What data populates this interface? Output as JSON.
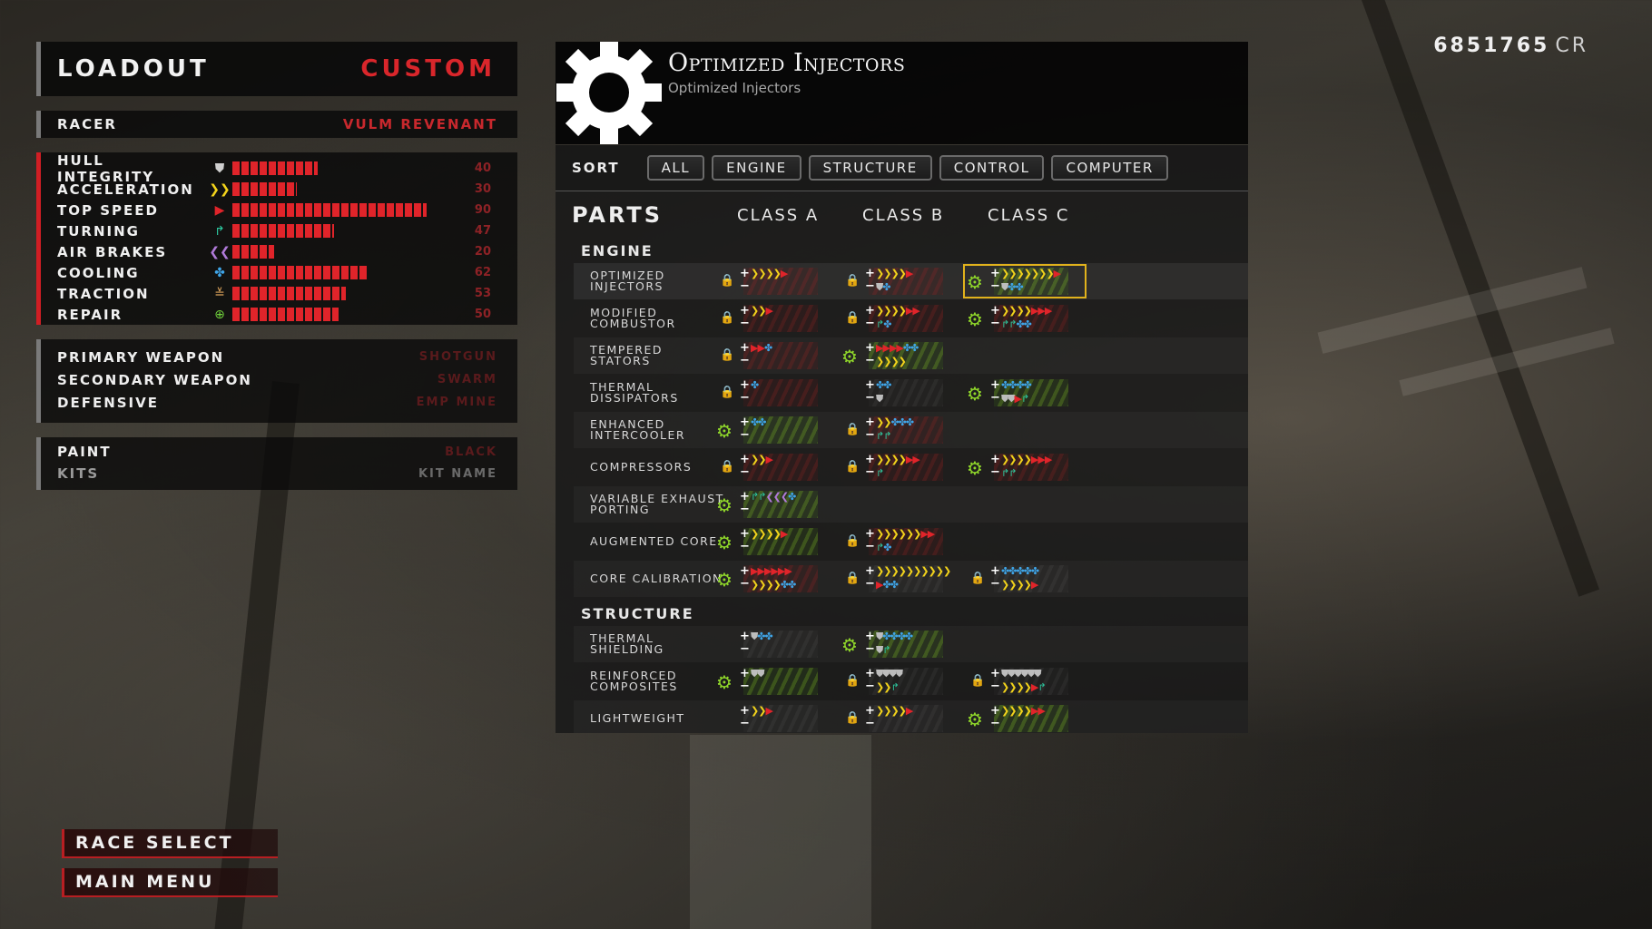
{
  "credits": {
    "value": "6851765",
    "unit": "CR"
  },
  "loadout": {
    "title": "LOADOUT",
    "mode": "CUSTOM"
  },
  "racer": {
    "label": "RACER",
    "value": "VULM REVENANT"
  },
  "stats": [
    {
      "label": "HULL INTEGRITY",
      "icon": "shield-icon",
      "glyph": "⛊",
      "color": "#cfcfcf",
      "value": "40",
      "fill": 0.37
    },
    {
      "label": "ACCELERATION",
      "icon": "acceleration-icon",
      "glyph": "❯❯",
      "color": "#f2d31b",
      "value": "30",
      "fill": 0.28
    },
    {
      "label": "TOP SPEED",
      "icon": "top-speed-icon",
      "glyph": "▶",
      "color": "#e0242a",
      "value": "90",
      "fill": 0.84
    },
    {
      "label": "TURNING",
      "icon": "turning-icon",
      "glyph": "↱",
      "color": "#2dc9a0",
      "value": "47",
      "fill": 0.44
    },
    {
      "label": "AIR BRAKES",
      "icon": "air-brakes-icon",
      "glyph": "❮❮",
      "color": "#b07ad9",
      "value": "20",
      "fill": 0.18
    },
    {
      "label": "COOLING",
      "icon": "cooling-icon",
      "glyph": "✤",
      "color": "#3fa5e8",
      "value": "62",
      "fill": 0.58
    },
    {
      "label": "TRACTION",
      "icon": "traction-icon",
      "glyph": "≚",
      "color": "#d9a25a",
      "value": "53",
      "fill": 0.49
    },
    {
      "label": "REPAIR",
      "icon": "repair-icon",
      "glyph": "⊕",
      "color": "#6fd13b",
      "value": "50",
      "fill": 0.46
    }
  ],
  "weapons": [
    {
      "label": "PRIMARY WEAPON",
      "value": "SHOTGUN"
    },
    {
      "label": "SECONDARY WEAPON",
      "value": "SWARM"
    },
    {
      "label": "DEFENSIVE",
      "value": "EMP MINE"
    }
  ],
  "paint": [
    {
      "label": "PAINT",
      "value": "BLACK"
    },
    {
      "label": "KITS",
      "value": "KIT NAME"
    }
  ],
  "menu": {
    "race_select": "RACE SELECT",
    "main_menu": "MAIN MENU"
  },
  "part": {
    "title": "Optimized Injectors",
    "subtitle": "Optimized Injectors",
    "icon": "gear-icon"
  },
  "sort": {
    "label": "SORT",
    "buttons": [
      "ALL",
      "ENGINE",
      "STRUCTURE",
      "CONTROL",
      "COMPUTER"
    ]
  },
  "parts_table": {
    "header": "PARTS",
    "classes": [
      "CLASS A",
      "CLASS B",
      "CLASS C"
    ],
    "sections": [
      {
        "name": "ENGINE",
        "rows": [
          {
            "name": "OPTIMIZED INJECTORS",
            "cells": [
              {
                "state": "locked",
                "bg": "red",
                "plus": "❯❯❯❯▶",
                "minus": ""
              },
              {
                "state": "locked",
                "bg": "red",
                "plus": "❯❯❯❯▶",
                "minus": "⛊✤"
              },
              {
                "state": "unlocked",
                "bg": "green",
                "highlight": true,
                "plus": "❯❯❯❯❯❯❯▶",
                "minus": "⛊✤✤"
              }
            ]
          },
          {
            "name": "MODIFIED COMBUSTOR",
            "cells": [
              {
                "state": "locked",
                "bg": "red",
                "plus": "❯❯▶",
                "minus": ""
              },
              {
                "state": "locked",
                "bg": "red",
                "plus": "❯❯❯❯▶▶",
                "minus": "↱✤"
              },
              {
                "state": "unlocked",
                "bg": "red",
                "plus": "❯❯❯❯▶▶▶",
                "minus": "↱↱✤✤"
              }
            ]
          },
          {
            "name": "TEMPERED STATORS",
            "cells": [
              {
                "state": "locked",
                "bg": "red",
                "plus": "▶▶✤",
                "minus": ""
              },
              {
                "state": "unlocked",
                "bg": "green",
                "plus": "▶▶▶▶✤✤",
                "minus": "❯❯❯❯"
              },
              null
            ]
          },
          {
            "name": "THERMAL DISSIPATORS",
            "cells": [
              {
                "state": "locked",
                "bg": "red",
                "plus": "✤",
                "minus": ""
              },
              {
                "state": "none",
                "bg": "",
                "plus": "✤✤",
                "minus": "⛊"
              },
              {
                "state": "unlocked",
                "bg": "green",
                "plus": "✤✤✤✤",
                "minus": "⛊⛊▶↱"
              }
            ]
          },
          {
            "name": "ENHANCED INTERCOOLER",
            "cells": [
              {
                "state": "unlocked",
                "bg": "green",
                "plus": "✤✤",
                "minus": ""
              },
              {
                "state": "locked",
                "bg": "red",
                "plus": "❯❯✤✤✤",
                "minus": "↱↱"
              },
              null
            ]
          },
          {
            "name": "COMPRESSORS",
            "cells": [
              {
                "state": "locked",
                "bg": "red",
                "plus": "❯❯▶",
                "minus": ""
              },
              {
                "state": "locked",
                "bg": "red",
                "plus": "❯❯❯❯▶▶",
                "minus": "↱"
              },
              {
                "state": "unlocked",
                "bg": "red",
                "plus": "❯❯❯❯▶▶▶",
                "minus": "↱↱"
              }
            ]
          },
          {
            "name": "VARIABLE EXHAUST PORTING",
            "cells": [
              {
                "state": "unlocked",
                "bg": "green",
                "plus": "↱↱❮❮❮✤",
                "minus": ""
              },
              null,
              null
            ]
          },
          {
            "name": "AUGMENTED CORE",
            "cells": [
              {
                "state": "unlocked",
                "bg": "green",
                "plus": "❯❯❯❯▶",
                "minus": ""
              },
              {
                "state": "locked",
                "bg": "red",
                "plus": "❯❯❯❯❯❯▶▶",
                "minus": "↱✤"
              },
              null
            ]
          },
          {
            "name": "CORE CALIBRATION",
            "cells": [
              {
                "state": "unlocked",
                "bg": "red",
                "plus": "▶▶▶▶▶▶",
                "minus": "❯❯❯❯✤✤"
              },
              {
                "state": "locked",
                "bg": "",
                "plus": "❯❯❯❯❯❯❯❯❯❯",
                "minus": "▶✤✤"
              },
              {
                "state": "locked",
                "bg": "",
                "plus": "✤✤✤✤✤",
                "minus": "❯❯❯❯▶"
              }
            ]
          }
        ]
      },
      {
        "name": "STRUCTURE",
        "rows": [
          {
            "name": "THERMAL SHIELDING",
            "cells": [
              {
                "state": "none",
                "bg": "",
                "plus": "⛊✤✤",
                "minus": ""
              },
              {
                "state": "unlocked",
                "bg": "green",
                "plus": "⛊✤✤✤✤",
                "minus": "⛊↱"
              },
              null
            ]
          },
          {
            "name": "REINFORCED COMPOSITES",
            "cells": [
              {
                "state": "unlocked",
                "bg": "green",
                "plus": "⛊⛊",
                "minus": ""
              },
              {
                "state": "locked",
                "bg": "",
                "plus": "⛊⛊⛊⛊",
                "minus": "❯❯↱"
              },
              {
                "state": "locked",
                "bg": "",
                "plus": "⛊⛊⛊⛊⛊⛊",
                "minus": "❯❯❯❯▶↱"
              }
            ]
          },
          {
            "name": "LIGHTWEIGHT",
            "cells": [
              {
                "state": "none",
                "bg": "",
                "plus": "❯❯▶",
                "minus": ""
              },
              {
                "state": "locked",
                "bg": "",
                "plus": "❯❯❯❯▶",
                "minus": ""
              },
              {
                "state": "unlocked",
                "bg": "green",
                "plus": "❯❯❯❯▶▶",
                "minus": ""
              }
            ]
          }
        ]
      }
    ]
  }
}
